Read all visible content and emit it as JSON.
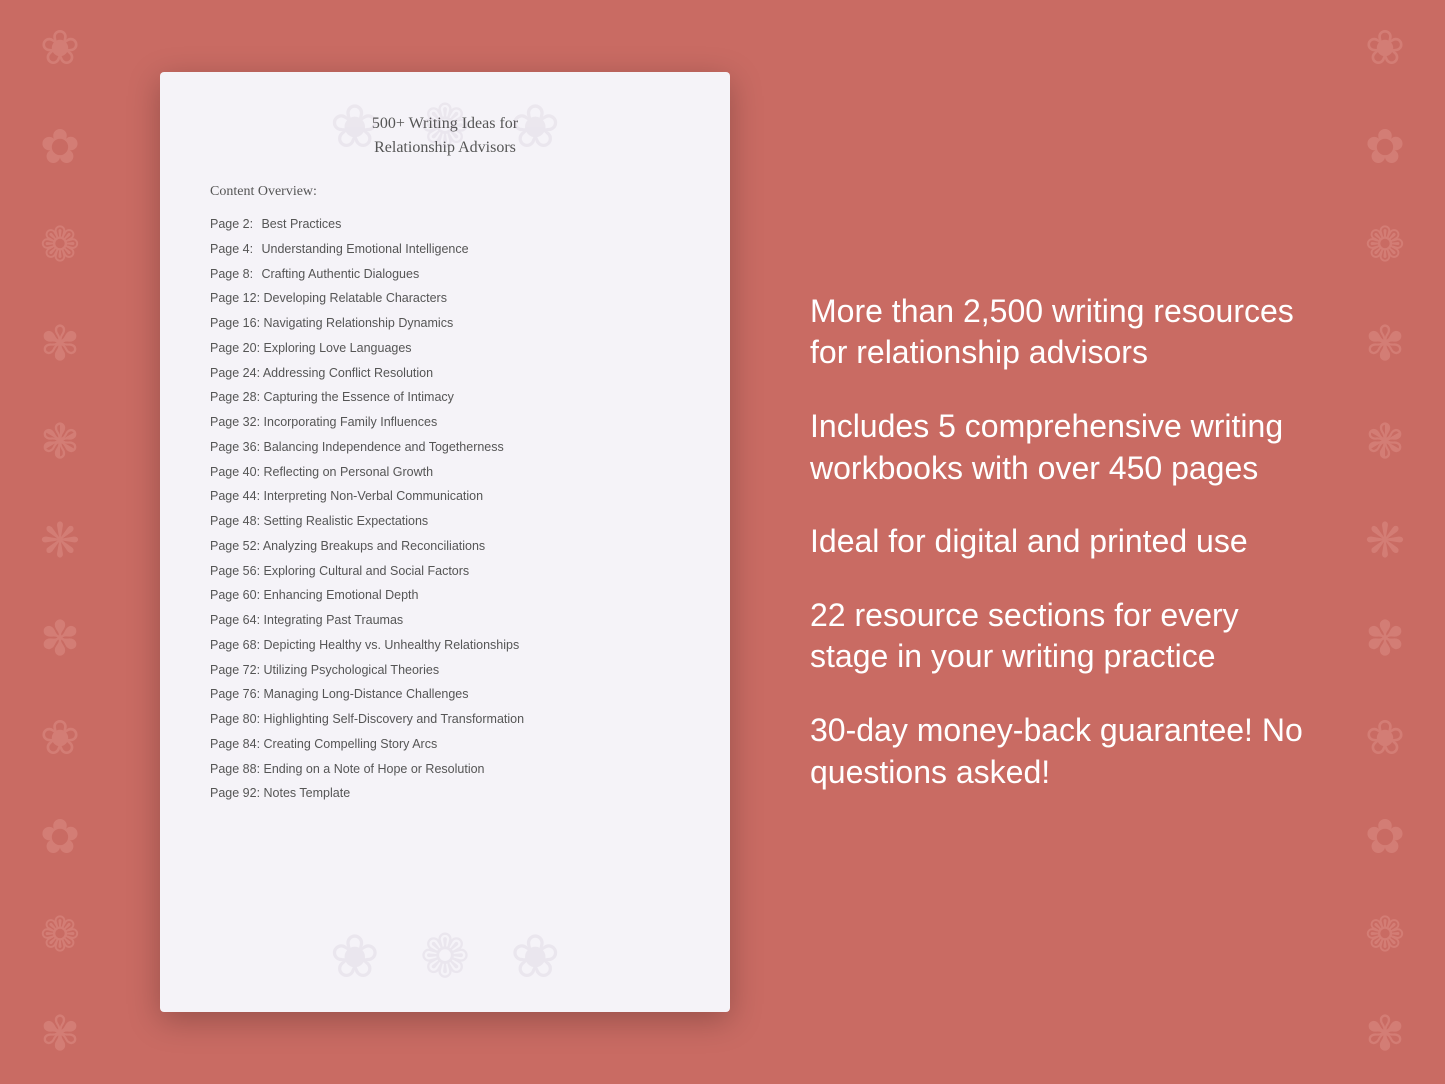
{
  "background_color": "#c96b63",
  "floral": {
    "symbols": [
      "❀",
      "✿",
      "❁",
      "✾",
      "❃",
      "❋",
      "✽",
      "❀",
      "✿",
      "❁"
    ]
  },
  "document": {
    "title_line1": "500+ Writing Ideas for",
    "title_line2": "Relationship Advisors",
    "content_label": "Content Overview:",
    "toc": [
      {
        "page": "Page  2:",
        "title": "Best Practices"
      },
      {
        "page": "Page  4:",
        "title": "Understanding Emotional Intelligence"
      },
      {
        "page": "Page  8:",
        "title": "Crafting Authentic Dialogues"
      },
      {
        "page": "Page 12:",
        "title": "Developing Relatable Characters"
      },
      {
        "page": "Page 16:",
        "title": "Navigating Relationship Dynamics"
      },
      {
        "page": "Page 20:",
        "title": "Exploring Love Languages"
      },
      {
        "page": "Page 24:",
        "title": "Addressing Conflict Resolution"
      },
      {
        "page": "Page 28:",
        "title": "Capturing the Essence of Intimacy"
      },
      {
        "page": "Page 32:",
        "title": "Incorporating Family Influences"
      },
      {
        "page": "Page 36:",
        "title": "Balancing Independence and Togetherness"
      },
      {
        "page": "Page 40:",
        "title": "Reflecting on Personal Growth"
      },
      {
        "page": "Page 44:",
        "title": "Interpreting Non-Verbal Communication"
      },
      {
        "page": "Page 48:",
        "title": "Setting Realistic Expectations"
      },
      {
        "page": "Page 52:",
        "title": "Analyzing Breakups and Reconciliations"
      },
      {
        "page": "Page 56:",
        "title": "Exploring Cultural and Social Factors"
      },
      {
        "page": "Page 60:",
        "title": "Enhancing Emotional Depth"
      },
      {
        "page": "Page 64:",
        "title": "Integrating Past Traumas"
      },
      {
        "page": "Page 68:",
        "title": "Depicting Healthy vs. Unhealthy Relationships"
      },
      {
        "page": "Page 72:",
        "title": "Utilizing Psychological Theories"
      },
      {
        "page": "Page 76:",
        "title": "Managing Long-Distance Challenges"
      },
      {
        "page": "Page 80:",
        "title": "Highlighting Self-Discovery and Transformation"
      },
      {
        "page": "Page 84:",
        "title": "Creating Compelling Story Arcs"
      },
      {
        "page": "Page 88:",
        "title": "Ending on a Note of Hope or Resolution"
      },
      {
        "page": "Page 92:",
        "title": "Notes Template"
      }
    ]
  },
  "info_points": [
    "More than 2,500 writing resources for relationship advisors",
    "Includes 5 comprehensive writing workbooks with over 450 pages",
    "Ideal for digital and printed use",
    "22 resource sections for every stage in your writing practice",
    "30-day money-back guarantee! No questions asked!"
  ]
}
